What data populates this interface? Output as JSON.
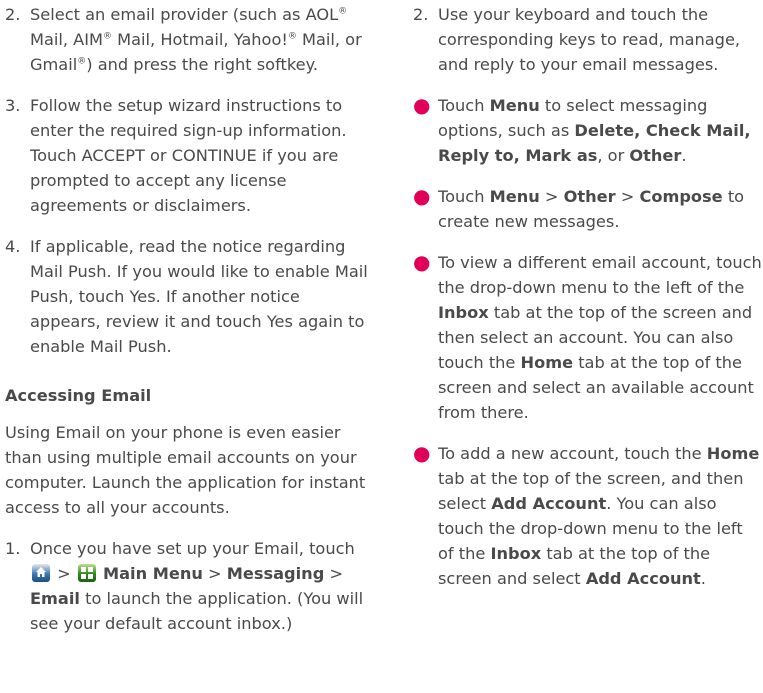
{
  "left": {
    "step2": {
      "num": "2.",
      "a": "Select an email provider (such as AOL",
      "b": " Mail, AIM",
      "c": " Mail, Hotmail, Yahoo!",
      "d": " Mail, or Gmail",
      "e": ") and press the right softkey."
    },
    "reg": "®",
    "step3": {
      "num": "3.",
      "text": "Follow the setup wizard instructions to enter the required sign-up information. Touch ACCEPT or CONTINUE if you are prompted to accept any license agreements or disclaimers."
    },
    "step4": {
      "num": "4.",
      "text": "If applicable, read the notice regarding Mail Push. If you would like to enable Mail Push, touch Yes. If another notice appears, review it and touch Yes again to enable Mail Push."
    },
    "heading": "Accessing Email",
    "intro": "Using Email on your phone is even easier than using multiple email accounts on your computer. Launch the application for instant access to all your accounts.",
    "step1": {
      "num": "1.",
      "a": "Once you have set up your Email, touch",
      "gt1": " > ",
      "main_menu": "Main Menu",
      "gt2": " > ",
      "messaging": "Messaging",
      "gt3": " > ",
      "email": "Email",
      "b": " to launch the application. (You will see your default account inbox.)"
    }
  },
  "right": {
    "step2": {
      "num": "2.",
      "text": "Use your keyboard and touch the corresponding keys to read, manage, and reply to your email messages."
    },
    "bullet_char": "●",
    "b1": {
      "a": "Touch ",
      "menu": "Menu",
      "b": " to select messaging options, such as ",
      "opts": "Delete, Check Mail, Reply to, Mark as",
      "c": ", or ",
      "other": "Other",
      "d": "."
    },
    "b2": {
      "a": "Touch ",
      "menu": "Menu",
      "gt1": " > ",
      "other": "Other",
      "gt2": " > ",
      "compose": "Compose",
      "b": " to create new messages."
    },
    "b3": {
      "a": "To view a different email account, touch the drop-down menu to the left of the ",
      "inbox": "Inbox",
      "b": " tab at the top of the screen and then select an account. You can also touch the ",
      "home": "Home",
      "c": " tab at the top of the screen and select an available account from there."
    },
    "b4": {
      "a": "To add a new account, touch the ",
      "home": "Home",
      "b": " tab at the top of the screen, and then select ",
      "add": "Add Account",
      "c": ". You can also touch the drop-down menu to the left of the ",
      "inbox": "Inbox",
      "d": " tab at the top of the screen and select ",
      "add2": "Add Account",
      "e": "."
    }
  },
  "colors": {
    "text": "#4a4a4a",
    "bullet": "#e0005a"
  },
  "icons": [
    "home-icon",
    "main-menu-icon"
  ]
}
